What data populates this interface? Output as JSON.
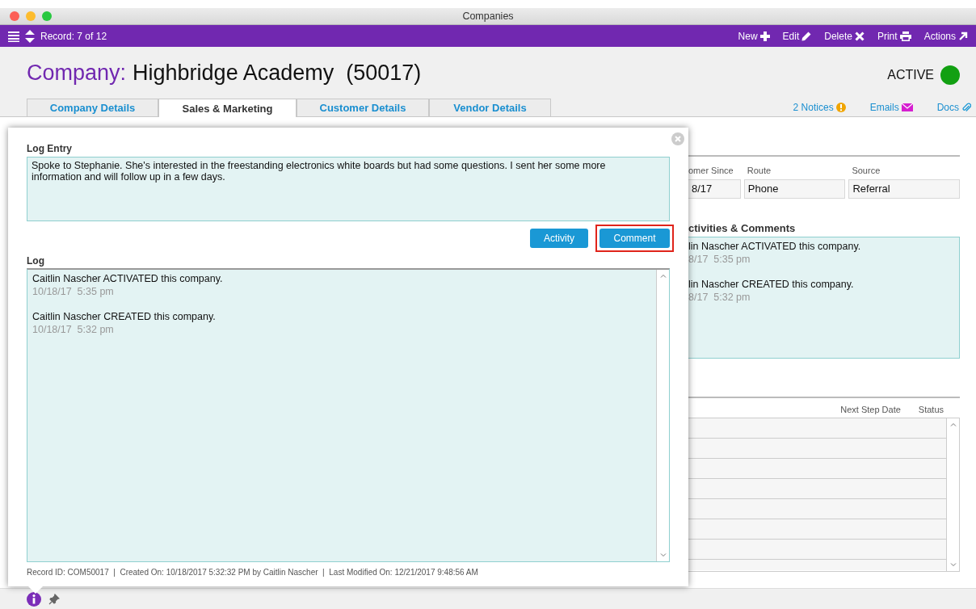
{
  "window": {
    "title": "Companies"
  },
  "toolbar": {
    "record": "Record: 7 of 12",
    "actions": [
      {
        "label": "New",
        "kind": "plus"
      },
      {
        "label": "Edit",
        "kind": "pencil"
      },
      {
        "label": "Delete",
        "kind": "cross"
      },
      {
        "label": "Print",
        "kind": "printer"
      },
      {
        "label": "Actions",
        "kind": "arrow"
      }
    ]
  },
  "header": {
    "label": "Company:",
    "name": "Highbridge Academy  (50017)",
    "status": "ACTIVE",
    "active": true
  },
  "tabs": [
    {
      "label": "Company Details",
      "selected": false
    },
    {
      "label": "Sales & Marketing",
      "selected": true
    },
    {
      "label": "Customer Details",
      "selected": false
    },
    {
      "label": "Vendor Details",
      "selected": false
    }
  ],
  "links": [
    {
      "label": "2 Notices",
      "kind": "notice"
    },
    {
      "label": "Emails",
      "kind": "email"
    },
    {
      "label": "Docs",
      "kind": "attachment"
    }
  ],
  "background": {
    "fields": [
      {
        "label": "omer Since",
        "value": "8/17"
      },
      {
        "label": "Route",
        "value": "Phone"
      },
      {
        "label": "Source",
        "value": "Referral"
      }
    ],
    "activities_title": "ctivities & Comments",
    "activities": [
      {
        "text": "lin Nascher ACTIVATED this company.",
        "time": "8/17  5:35 pm"
      },
      {
        "text": "lin Nascher CREATED this company.",
        "time": "8/17  5:32 pm"
      }
    ],
    "table": {
      "columns": [
        "Next Step Date",
        "Status"
      ]
    }
  },
  "popup": {
    "entry_label": "Log Entry",
    "entry_value": "Spoke to Stephanie. She's interested in the freestanding electronics white boards but had some questions. I sent her some more information and will follow up in a few days.",
    "buttons": [
      {
        "label": "Activity",
        "highlighted": false
      },
      {
        "label": "Comment",
        "highlighted": true
      }
    ],
    "log_label": "Log",
    "log": [
      {
        "text": "Caitlin Nascher ACTIVATED this company.",
        "time": "10/18/17  5:35 pm"
      },
      {
        "text": "Caitlin Nascher CREATED this company.",
        "time": "10/18/17  5:32 pm"
      }
    ],
    "footer": "Record ID: COM50017  |  Created On: 10/18/2017 5:32:32 PM by Caitlin Nascher  |  Last Modified On: 12/21/2017 9:48:56 AM"
  }
}
